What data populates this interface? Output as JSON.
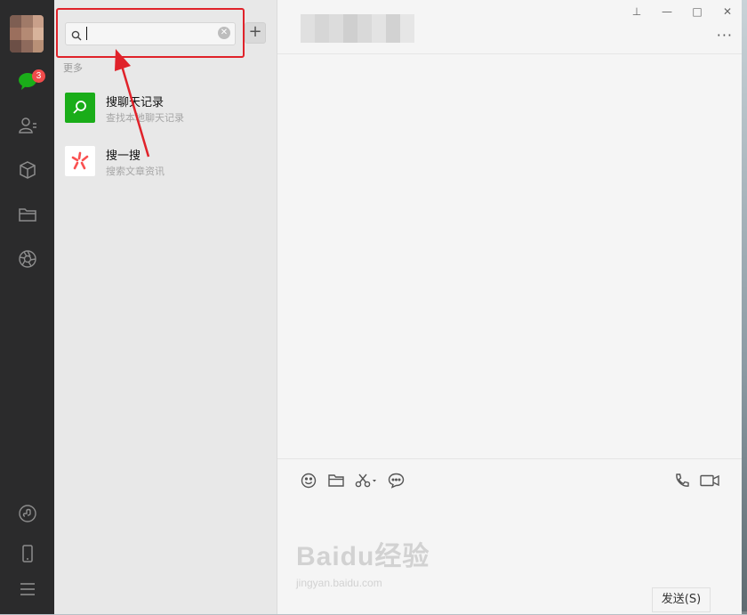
{
  "sidebar": {
    "badge_count": "3",
    "icons": [
      "chat-icon",
      "contacts-icon",
      "favorites-icon",
      "files-icon",
      "moments-icon",
      "mini-program-icon",
      "phone-icon",
      "menu-icon"
    ]
  },
  "search": {
    "value": "",
    "placeholder": "",
    "add_label": "+"
  },
  "results": {
    "section_label": "更多",
    "items": [
      {
        "title": "搜聊天记录",
        "desc": "查找本地聊天记录",
        "icon": "search-icon",
        "color": "#1aad19"
      },
      {
        "title": "搜一搜",
        "desc": "搜索文章资讯",
        "icon": "sousou-icon",
        "color": "#fa5151"
      }
    ]
  },
  "window": {
    "pin": "⊥",
    "minimize": "—",
    "maximize": "□",
    "close": "✕",
    "more": "···"
  },
  "composer": {
    "tools": [
      "emoji-icon",
      "folder-icon",
      "scissors-icon",
      "chat-history-icon"
    ],
    "right_tools": [
      "voice-call-icon",
      "video-call-icon"
    ],
    "send_label": "发送(S)"
  },
  "watermark": {
    "main": "Baidu经验",
    "sub": "jingyan.baidu.com"
  }
}
